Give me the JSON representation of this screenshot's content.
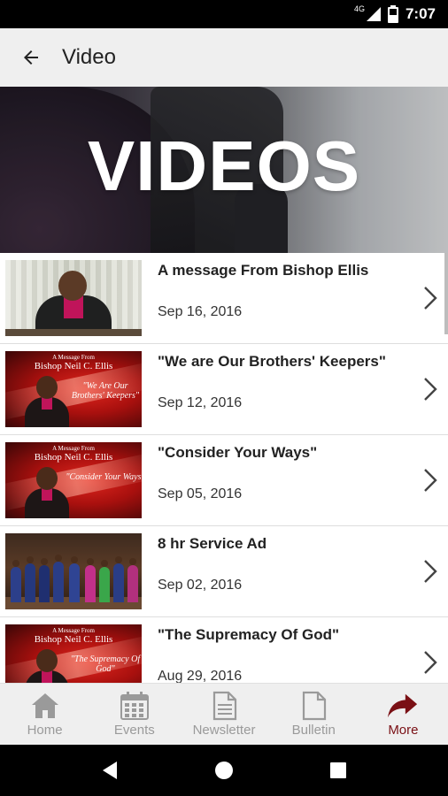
{
  "status_bar": {
    "network": "4G",
    "time": "7:07"
  },
  "app_bar": {
    "title": "Video",
    "back_icon": "arrow-left-icon"
  },
  "hero": {
    "title": "VIDEOS"
  },
  "videos": [
    {
      "title": "A message From Bishop Ellis",
      "date": "Sep 16, 2016",
      "thumb": "speaker"
    },
    {
      "title": "\"We are Our Brothers' Keepers\"",
      "date": "Sep 12, 2016",
      "thumb": "red",
      "thumb_top": "A Message From",
      "thumb_name": "Bishop Neil C. Ellis",
      "thumb_quote": "\"We Are Our Brothers' Keepers\""
    },
    {
      "title": "\"Consider Your Ways\"",
      "date": "Sep 05, 2016",
      "thumb": "red",
      "thumb_top": "A Message From",
      "thumb_name": "Bishop Neil C. Ellis",
      "thumb_quote": "\"Consider Your Ways\""
    },
    {
      "title": "8 hr Service Ad",
      "date": "Sep 02, 2016",
      "thumb": "stage"
    },
    {
      "title": "\"The Supremacy Of God\"",
      "date": "Aug 29, 2016",
      "thumb": "red",
      "thumb_top": "A Message From",
      "thumb_name": "Bishop Neil C. Ellis",
      "thumb_quote": "\"The Supremacy Of God\""
    }
  ],
  "bottom_nav": [
    {
      "label": "Home",
      "icon": "home-icon",
      "active": false
    },
    {
      "label": "Events",
      "icon": "calendar-icon",
      "active": false
    },
    {
      "label": "Newsletter",
      "icon": "newsletter-icon",
      "active": false
    },
    {
      "label": "Bulletin",
      "icon": "document-icon",
      "active": false
    },
    {
      "label": "More",
      "icon": "share-arrow-icon",
      "active": true
    }
  ],
  "colors": {
    "accent": "#7a1015",
    "app_bar": "#efefef",
    "nav_inactive": "#9a9a9a"
  }
}
